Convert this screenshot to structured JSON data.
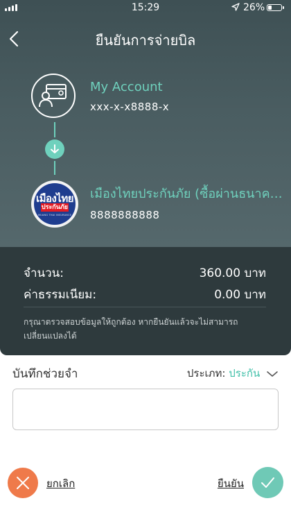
{
  "status_bar": {
    "time": "15:29",
    "battery": "26%",
    "battery_level": 0.26
  },
  "header": {
    "title": "ยืนยันการจ่ายบิล",
    "back_icon": "chevron-left-icon"
  },
  "from_account": {
    "name": "My Account",
    "number": "xxx-x-x8888-x",
    "icon": "account-card-icon"
  },
  "to_payee": {
    "name": "เมืองไทยประกันภัย (ซื้อผ่านธนาคาร)",
    "number": "8888888888",
    "logo_line1": "เมืองไทย",
    "logo_line2": "ประกันภัย",
    "logo_line3": "MUANG THAI INSURANCE"
  },
  "summary": {
    "amount_label": "จำนวน:",
    "amount_value": "360.00 บาท",
    "fee_label": "ค่าธรรมเนียม:",
    "fee_value": "0.00 บาท",
    "note": "กรุณาตรวจสอบข้อมูลให้ถูกต้อง หากยืนยันแล้วจะไม่สามารถเปลี่ยนแปลงได้"
  },
  "memo": {
    "label": "บันทึกช่วยจำ",
    "type_label": "ประเภท:",
    "type_value": "ประกัน",
    "value": ""
  },
  "actions": {
    "cancel_label": "ยกเลิก",
    "confirm_label": "ยืนยัน"
  },
  "colors": {
    "accent": "#6fd1bd",
    "cancel": "#ef7a4a",
    "confirm": "#6fc9b6",
    "header_bg": "#4a5d61",
    "summary_bg": "#2e3a3d"
  }
}
